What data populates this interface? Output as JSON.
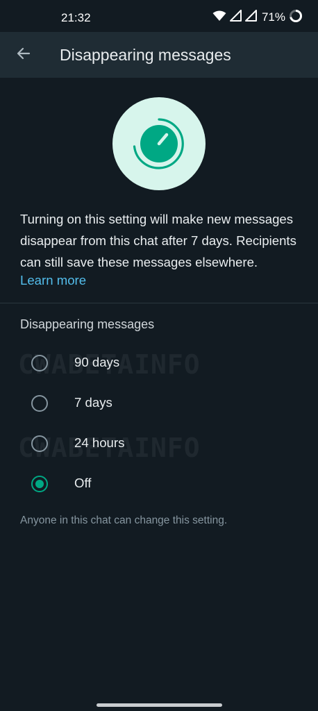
{
  "status_bar": {
    "time": "21:32",
    "battery": "71%",
    "icons": [
      "wifi-icon",
      "signal-icon",
      "signal-icon",
      "battery-ring-icon"
    ]
  },
  "app_bar": {
    "back_icon": "arrow-left-icon",
    "title": "Disappearing messages"
  },
  "hero": {
    "icon": "timer-icon",
    "background": "#d7f5ec",
    "accent": "#00a884"
  },
  "description": "Turning on this setting will make new messages disappear from this chat after 7 days. Recipients can still save these messages elsewhere.",
  "learn_more": "Learn more",
  "section_title": "Disappearing messages",
  "options": [
    {
      "label": "90 days",
      "selected": false
    },
    {
      "label": "7 days",
      "selected": false
    },
    {
      "label": "24 hours",
      "selected": false
    },
    {
      "label": "Off",
      "selected": true
    }
  ],
  "footer_note": "Anyone in this chat can change this setting.",
  "watermark": "CWABETAINFO",
  "colors": {
    "background": "#121b22",
    "app_bar": "#1f2c34",
    "accent": "#00a884",
    "link": "#53bdeb",
    "secondary_text": "#8696a0"
  }
}
